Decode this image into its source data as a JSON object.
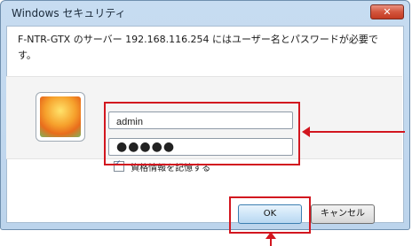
{
  "window": {
    "title": "Windows セキュリティ",
    "close_label": "✕"
  },
  "message": "F-NTR-GTX のサーバー 192.168.116.254 にはユーザー名とパスワードが必要です。",
  "credentials": {
    "username": "admin",
    "password_mask": "●●●●●",
    "remember_label": "資格情報を記憶する",
    "remember_checked": true
  },
  "buttons": {
    "ok": "OK",
    "cancel": "キャンセル"
  },
  "annotation": {
    "color": "#d2161f"
  }
}
